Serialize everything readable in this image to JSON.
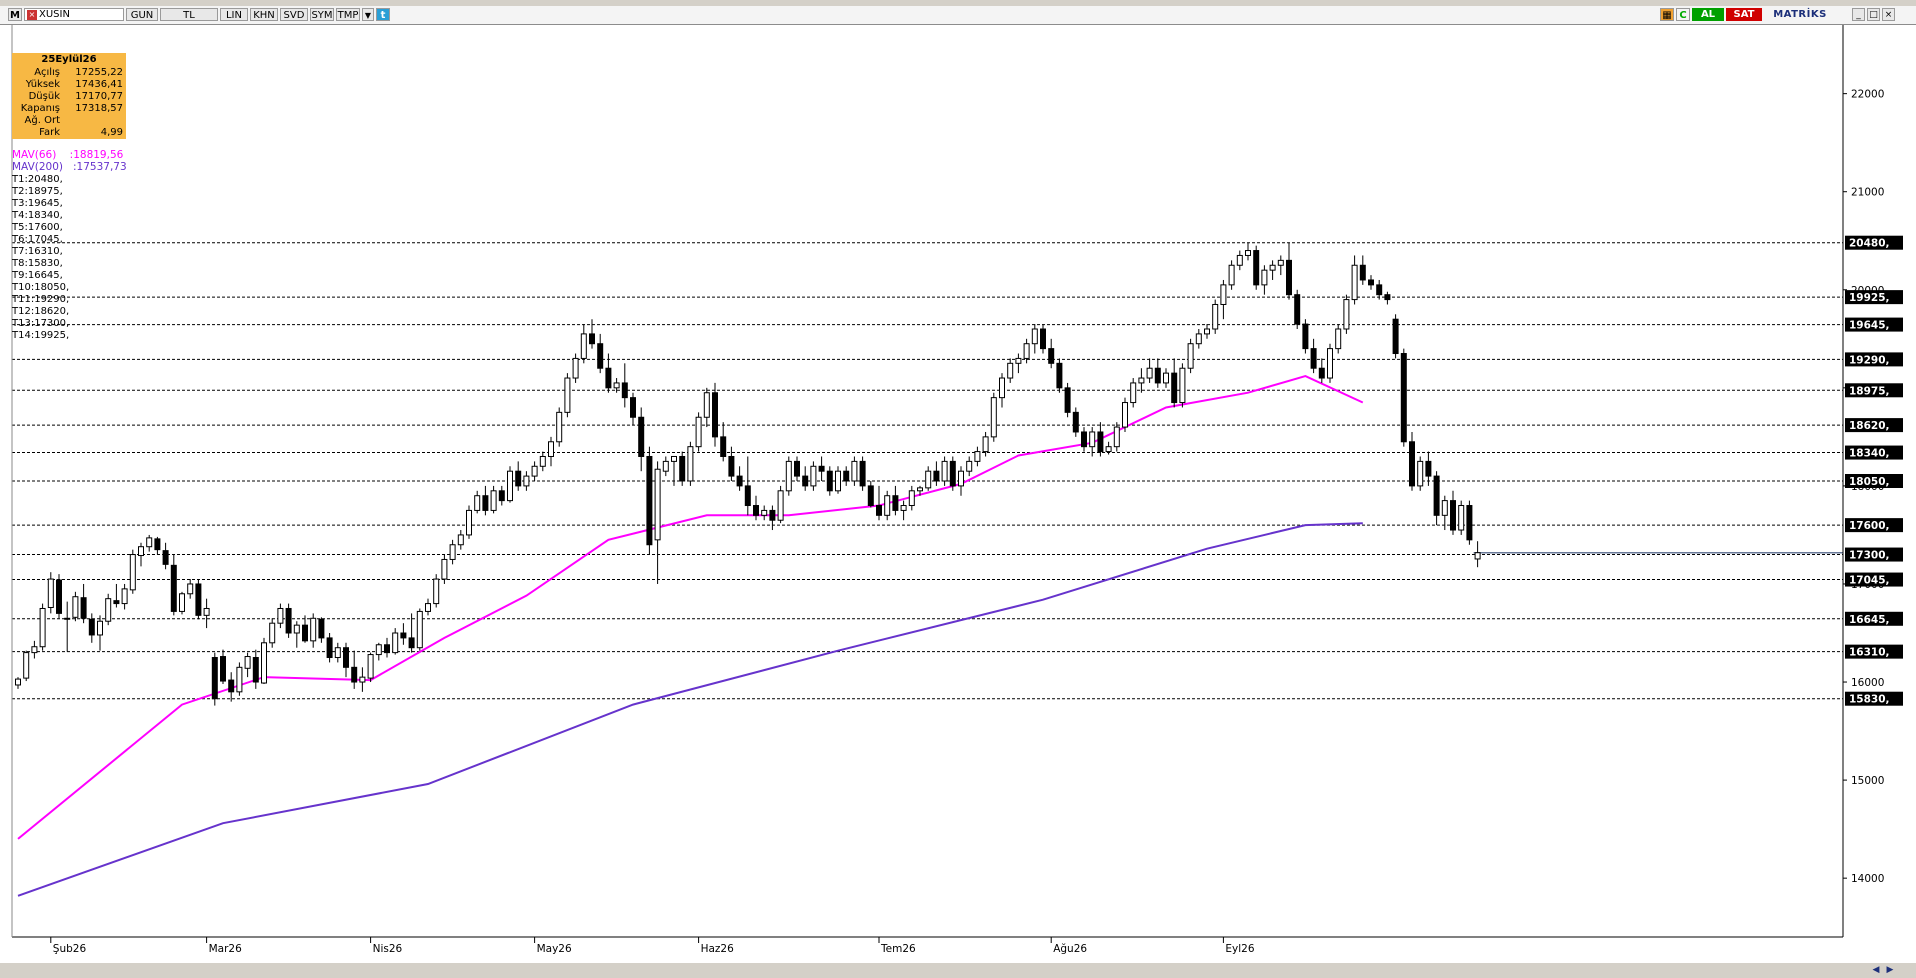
{
  "toolbar": {
    "menu_icon": "M",
    "symbol": "XUSIN",
    "buttons": [
      "GUN",
      "TL",
      "LIN",
      "KHN",
      "SVD",
      "SYM",
      "TMP"
    ],
    "dropdown_icon": "chevron-down-icon",
    "twitter_icon": "twitter-icon",
    "right_icons": [
      "chart-icon",
      "refresh-icon"
    ],
    "buy_label": "AL",
    "sell_label": "SAT",
    "brand": "MATRİKS",
    "window_controls": [
      "minimize-icon",
      "maximize-icon",
      "close-icon"
    ],
    "colors": {
      "buy": "#00a000",
      "sell": "#d00000",
      "brand": "#1c2f7a"
    }
  },
  "info": {
    "date": "25Eylül26",
    "rows": [
      {
        "label": "Açılış",
        "value": "17255,22"
      },
      {
        "label": "Yüksek",
        "value": "17436,41"
      },
      {
        "label": "Düşük",
        "value": "17170,77"
      },
      {
        "label": "Kapanış",
        "value": "17318,57"
      },
      {
        "label": "Ağ. Ort",
        "value": ""
      },
      {
        "label": "Fark",
        "value": "4,99"
      }
    ],
    "box_color": "#f7b844"
  },
  "indicators": {
    "mav66": {
      "label": "MAV(66)",
      "value": ":18819,56",
      "color": "#ff00ff"
    },
    "mav200": {
      "label": "MAV(200)",
      "value": ":17537,73",
      "color": "#6633cc"
    }
  },
  "trend_levels": [
    {
      "id": "T1",
      "value": 20480
    },
    {
      "id": "T2",
      "value": 18975
    },
    {
      "id": "T3",
      "value": 19645
    },
    {
      "id": "T4",
      "value": 18340
    },
    {
      "id": "T5",
      "value": 17600
    },
    {
      "id": "T6",
      "value": 17045
    },
    {
      "id": "T7",
      "value": 16310
    },
    {
      "id": "T8",
      "value": 15830
    },
    {
      "id": "T9",
      "value": 16645
    },
    {
      "id": "T10",
      "value": 18050
    },
    {
      "id": "T11",
      "value": 19290
    },
    {
      "id": "T12",
      "value": 18620
    },
    {
      "id": "T13",
      "value": 17300
    },
    {
      "id": "T14",
      "value": 19925
    }
  ],
  "chart_data": {
    "type": "candlestick",
    "y_axis": {
      "ticks": [
        14000,
        15000,
        16000,
        17000,
        18000,
        19000,
        20000,
        21000,
        22000
      ],
      "ylim": [
        13400,
        22700
      ],
      "side": "right"
    },
    "x_labels": [
      {
        "label": "Şub26",
        "index": 4
      },
      {
        "label": "Mar26",
        "index": 23
      },
      {
        "label": "Nis26",
        "index": 43
      },
      {
        "label": "May26",
        "index": 63
      },
      {
        "label": "Haz26",
        "index": 83
      },
      {
        "label": "Tem26",
        "index": 105
      },
      {
        "label": "Ağu26",
        "index": 126
      },
      {
        "label": "Eyl26",
        "index": 147
      }
    ],
    "level_labels": [
      "20480,",
      "19925,",
      "19645,",
      "19290,",
      "18975,",
      "18620,",
      "18340,",
      "18050,",
      "17600,",
      "17300,",
      "17045,",
      "16645,",
      "16310,",
      "15830,"
    ],
    "highlighted_levels": [
      "20480,",
      "19925,",
      "19645,",
      "19290,",
      "18975,",
      "18620,",
      "18340,",
      "18050,",
      "17600,",
      "17300,",
      "17045,",
      "16645,",
      "16310,",
      "15830,"
    ],
    "last_close": 17318.57,
    "ma66": [
      [
        0,
        14400
      ],
      [
        20,
        15770
      ],
      [
        30,
        16050
      ],
      [
        43,
        16020
      ],
      [
        52,
        16450
      ],
      [
        62,
        16880
      ],
      [
        72,
        17450
      ],
      [
        84,
        17700
      ],
      [
        94,
        17700
      ],
      [
        105,
        17800
      ],
      [
        115,
        18020
      ],
      [
        122,
        18310
      ],
      [
        131,
        18440
      ],
      [
        140,
        18800
      ],
      [
        150,
        18950
      ],
      [
        157,
        19120
      ],
      [
        164,
        18850
      ]
    ],
    "ma200": [
      [
        0,
        13820
      ],
      [
        25,
        14560
      ],
      [
        50,
        14960
      ],
      [
        75,
        15770
      ],
      [
        100,
        16320
      ],
      [
        125,
        16840
      ],
      [
        145,
        17360
      ],
      [
        157,
        17600
      ],
      [
        164,
        17620
      ]
    ],
    "candles": [
      [
        15970,
        16050,
        15930,
        16030
      ],
      [
        16040,
        16320,
        16010,
        16300
      ],
      [
        16300,
        16420,
        16240,
        16360
      ],
      [
        16360,
        16800,
        16320,
        16750
      ],
      [
        16760,
        17120,
        16700,
        17050
      ],
      [
        17040,
        17100,
        16650,
        16700
      ],
      [
        16640,
        16820,
        16310,
        16650
      ],
      [
        16660,
        16920,
        16620,
        16870
      ],
      [
        16860,
        17000,
        16600,
        16650
      ],
      [
        16640,
        16700,
        16400,
        16480
      ],
      [
        16480,
        16680,
        16320,
        16620
      ],
      [
        16620,
        16900,
        16580,
        16850
      ],
      [
        16830,
        17000,
        16760,
        16800
      ],
      [
        16800,
        17000,
        16740,
        16950
      ],
      [
        16940,
        17350,
        16900,
        17300
      ],
      [
        17290,
        17420,
        17180,
        17380
      ],
      [
        17380,
        17500,
        17330,
        17470
      ],
      [
        17460,
        17480,
        17300,
        17350
      ],
      [
        17340,
        17420,
        17150,
        17200
      ],
      [
        17190,
        17300,
        16680,
        16720
      ],
      [
        16720,
        16920,
        16690,
        16900
      ],
      [
        16900,
        17050,
        16850,
        17000
      ],
      [
        17000,
        17050,
        16640,
        16680
      ],
      [
        16680,
        16850,
        16550,
        16750
      ],
      [
        16250,
        16300,
        15760,
        15830
      ],
      [
        16260,
        16330,
        15980,
        16010
      ],
      [
        16020,
        16100,
        15800,
        15900
      ],
      [
        15900,
        16200,
        15860,
        16150
      ],
      [
        16140,
        16300,
        16050,
        16260
      ],
      [
        16250,
        16330,
        15930,
        16000
      ],
      [
        15990,
        16450,
        15980,
        16400
      ],
      [
        16400,
        16650,
        16350,
        16600
      ],
      [
        16600,
        16800,
        16550,
        16750
      ],
      [
        16750,
        16800,
        16450,
        16500
      ],
      [
        16500,
        16620,
        16350,
        16580
      ],
      [
        16580,
        16680,
        16400,
        16420
      ],
      [
        16420,
        16700,
        16350,
        16650
      ],
      [
        16640,
        16660,
        16400,
        16450
      ],
      [
        16450,
        16500,
        16200,
        16250
      ],
      [
        16250,
        16400,
        16200,
        16350
      ],
      [
        16350,
        16400,
        16050,
        16150
      ],
      [
        16150,
        16320,
        15930,
        16000
      ],
      [
        16000,
        16150,
        15900,
        16050
      ],
      [
        16040,
        16300,
        16000,
        16280
      ],
      [
        16280,
        16400,
        16220,
        16380
      ],
      [
        16380,
        16450,
        16250,
        16300
      ],
      [
        16300,
        16550,
        16280,
        16500
      ],
      [
        16500,
        16600,
        16380,
        16450
      ],
      [
        16450,
        16700,
        16300,
        16350
      ],
      [
        16350,
        16750,
        16320,
        16720
      ],
      [
        16720,
        16850,
        16680,
        16800
      ],
      [
        16800,
        17100,
        16760,
        17050
      ],
      [
        17050,
        17300,
        17000,
        17250
      ],
      [
        17250,
        17450,
        17200,
        17400
      ],
      [
        17400,
        17550,
        17350,
        17500
      ],
      [
        17500,
        17800,
        17460,
        17750
      ],
      [
        17750,
        17950,
        17720,
        17900
      ],
      [
        17900,
        18000,
        17700,
        17750
      ],
      [
        17750,
        18000,
        17720,
        17950
      ],
      [
        17950,
        18000,
        17800,
        17850
      ],
      [
        17850,
        18200,
        17830,
        18150
      ],
      [
        18150,
        18250,
        17950,
        18000
      ],
      [
        18000,
        18150,
        17950,
        18100
      ],
      [
        18100,
        18250,
        18050,
        18200
      ],
      [
        18200,
        18350,
        18150,
        18300
      ],
      [
        18300,
        18500,
        18200,
        18450
      ],
      [
        18450,
        18800,
        18400,
        18750
      ],
      [
        18750,
        19150,
        18700,
        19100
      ],
      [
        19100,
        19350,
        19050,
        19300
      ],
      [
        19300,
        19650,
        19250,
        19550
      ],
      [
        19550,
        19700,
        19400,
        19450
      ],
      [
        19450,
        19550,
        19150,
        19200
      ],
      [
        19200,
        19350,
        18950,
        19000
      ],
      [
        19000,
        19100,
        18950,
        19050
      ],
      [
        19050,
        19250,
        18800,
        18900
      ],
      [
        18900,
        18950,
        18620,
        18700
      ],
      [
        18700,
        18800,
        18150,
        18300
      ],
      [
        18300,
        18400,
        17300,
        17400
      ],
      [
        17450,
        18250,
        17000,
        18170
      ],
      [
        18150,
        18300,
        18100,
        18250
      ],
      [
        18250,
        18300,
        18000,
        18300
      ],
      [
        18300,
        18350,
        18000,
        18050
      ],
      [
        18050,
        18450,
        18000,
        18400
      ],
      [
        18400,
        18750,
        18350,
        18700
      ],
      [
        18700,
        19000,
        18600,
        18950
      ],
      [
        18950,
        19050,
        18400,
        18500
      ],
      [
        18500,
        18650,
        18250,
        18300
      ],
      [
        18300,
        18400,
        18050,
        18100
      ],
      [
        18100,
        18200,
        17950,
        18000
      ],
      [
        18000,
        18300,
        17700,
        17800
      ],
      [
        17800,
        17900,
        17650,
        17700
      ],
      [
        17700,
        17800,
        17650,
        17750
      ],
      [
        17750,
        17800,
        17550,
        17650
      ],
      [
        17650,
        18000,
        17620,
        17950
      ],
      [
        17950,
        18300,
        17900,
        18250
      ],
      [
        18250,
        18300,
        18050,
        18100
      ],
      [
        18100,
        18200,
        17950,
        18000
      ],
      [
        18000,
        18250,
        17950,
        18200
      ],
      [
        18200,
        18300,
        18050,
        18150
      ],
      [
        18150,
        18200,
        17900,
        17950
      ],
      [
        17950,
        18200,
        17920,
        18150
      ],
      [
        18150,
        18200,
        18000,
        18050
      ],
      [
        18050,
        18300,
        18000,
        18250
      ],
      [
        18250,
        18300,
        17950,
        18000
      ],
      [
        18000,
        18050,
        17780,
        17800
      ],
      [
        17800,
        18000,
        17650,
        17700
      ],
      [
        17700,
        17950,
        17650,
        17900
      ],
      [
        17900,
        18000,
        17700,
        17750
      ],
      [
        17750,
        17850,
        17650,
        17800
      ],
      [
        17800,
        18000,
        17750,
        17950
      ],
      [
        17950,
        18000,
        17900,
        17980
      ],
      [
        17980,
        18200,
        17950,
        18150
      ],
      [
        18150,
        18250,
        18000,
        18050
      ],
      [
        18050,
        18300,
        18000,
        18250
      ],
      [
        18250,
        18300,
        17950,
        18000
      ],
      [
        18000,
        18200,
        17900,
        18150
      ],
      [
        18150,
        18300,
        18100,
        18250
      ],
      [
        18250,
        18400,
        18200,
        18350
      ],
      [
        18350,
        18550,
        18300,
        18500
      ],
      [
        18500,
        18950,
        18450,
        18900
      ],
      [
        18900,
        19150,
        18800,
        19100
      ],
      [
        19100,
        19300,
        19050,
        19250
      ],
      [
        19250,
        19350,
        19150,
        19300
      ],
      [
        19300,
        19500,
        19250,
        19450
      ],
      [
        19450,
        19650,
        19350,
        19600
      ],
      [
        19600,
        19650,
        19350,
        19400
      ],
      [
        19400,
        19500,
        19200,
        19250
      ],
      [
        19250,
        19300,
        18950,
        19000
      ],
      [
        19000,
        19050,
        18700,
        18750
      ],
      [
        18750,
        18800,
        18500,
        18550
      ],
      [
        18550,
        18600,
        18350,
        18400
      ],
      [
        18400,
        18600,
        18300,
        18550
      ],
      [
        18550,
        18650,
        18300,
        18350
      ],
      [
        18350,
        18450,
        18320,
        18400
      ],
      [
        18400,
        18650,
        18350,
        18600
      ],
      [
        18600,
        18900,
        18550,
        18850
      ],
      [
        18850,
        19100,
        18800,
        19050
      ],
      [
        19050,
        19200,
        18950,
        19100
      ],
      [
        19100,
        19300,
        19050,
        19200
      ],
      [
        19200,
        19300,
        19000,
        19050
      ],
      [
        19050,
        19200,
        19000,
        19150
      ],
      [
        19150,
        19300,
        18800,
        18850
      ],
      [
        18850,
        19250,
        18800,
        19200
      ],
      [
        19200,
        19500,
        19150,
        19450
      ],
      [
        19450,
        19600,
        19400,
        19550
      ],
      [
        19550,
        19650,
        19500,
        19600
      ],
      [
        19600,
        19900,
        19550,
        19850
      ],
      [
        19850,
        20100,
        19700,
        20050
      ],
      [
        20050,
        20300,
        20000,
        20250
      ],
      [
        20250,
        20400,
        20200,
        20350
      ],
      [
        20350,
        20480,
        20300,
        20400
      ],
      [
        20400,
        20450,
        20000,
        20050
      ],
      [
        20050,
        20250,
        19950,
        20200
      ],
      [
        20200,
        20300,
        20100,
        20250
      ],
      [
        20250,
        20350,
        20150,
        20300
      ],
      [
        20300,
        20480,
        19900,
        19950
      ],
      [
        19950,
        20000,
        19600,
        19650
      ],
      [
        19650,
        19700,
        19350,
        19400
      ],
      [
        19400,
        19500,
        19150,
        19200
      ],
      [
        19200,
        19300,
        19050,
        19100
      ],
      [
        19100,
        19450,
        19050,
        19400
      ],
      [
        19400,
        19650,
        19350,
        19600
      ],
      [
        19600,
        19950,
        19550,
        19900
      ],
      [
        19900,
        20350,
        19850,
        20250
      ],
      [
        20250,
        20350,
        20050,
        20100
      ],
      [
        20100,
        20150,
        20000,
        20050
      ],
      [
        20050,
        20100,
        19900,
        19950
      ],
      [
        19950,
        19980,
        19850,
        19900
      ],
      [
        19700,
        19750,
        19300,
        19350
      ],
      [
        19350,
        19400,
        18400,
        18450
      ],
      [
        18450,
        18550,
        17950,
        18000
      ],
      [
        18000,
        18300,
        17950,
        18250
      ],
      [
        18250,
        18350,
        18000,
        18100
      ],
      [
        18100,
        18150,
        17600,
        17700
      ],
      [
        17700,
        17900,
        17550,
        17850
      ],
      [
        17850,
        17950,
        17500,
        17550
      ],
      [
        17550,
        17850,
        17500,
        17800
      ],
      [
        17800,
        17850,
        17400,
        17450
      ],
      [
        17255,
        17436,
        17171,
        17319
      ]
    ]
  }
}
